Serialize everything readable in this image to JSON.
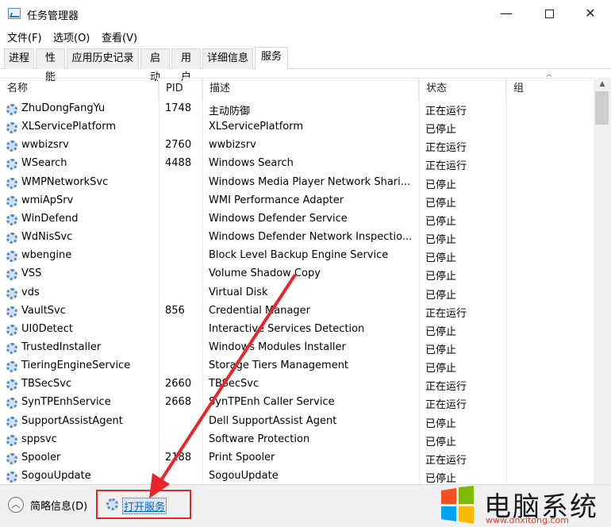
{
  "window": {
    "title": "任务管理器",
    "min_glyph": "—",
    "close_glyph": "✕"
  },
  "menu": [
    "文件(F)",
    "选项(O)",
    "查看(V)"
  ],
  "tabs": [
    {
      "label": "进程",
      "active": false
    },
    {
      "label": "性能",
      "active": false
    },
    {
      "label": "应用历史记录",
      "active": false
    },
    {
      "label": "启动",
      "active": false
    },
    {
      "label": "用户",
      "active": false
    },
    {
      "label": "详细信息",
      "active": false
    },
    {
      "label": "服务",
      "active": true
    }
  ],
  "columns": {
    "name": "名称",
    "pid": "PID",
    "desc": "描述",
    "status": "状态",
    "group": "组"
  },
  "services": [
    {
      "name": "ZhuDongFangYu",
      "pid": "1748",
      "desc": "主动防御",
      "status": "正在运行"
    },
    {
      "name": "XLServicePlatform",
      "pid": "",
      "desc": "XLServicePlatform",
      "status": "已停止"
    },
    {
      "name": "wwbizsrv",
      "pid": "2760",
      "desc": "wwbizsrv",
      "status": "正在运行"
    },
    {
      "name": "WSearch",
      "pid": "4488",
      "desc": "Windows Search",
      "status": "正在运行"
    },
    {
      "name": "WMPNetworkSvc",
      "pid": "",
      "desc": "Windows Media Player Network Shari...",
      "status": "已停止"
    },
    {
      "name": "wmiApSrv",
      "pid": "",
      "desc": "WMI Performance Adapter",
      "status": "已停止"
    },
    {
      "name": "WinDefend",
      "pid": "",
      "desc": "Windows Defender Service",
      "status": "已停止"
    },
    {
      "name": "WdNisSvc",
      "pid": "",
      "desc": "Windows Defender Network Inspectio...",
      "status": "已停止"
    },
    {
      "name": "wbengine",
      "pid": "",
      "desc": "Block Level Backup Engine Service",
      "status": "已停止"
    },
    {
      "name": "VSS",
      "pid": "",
      "desc": "Volume Shadow Copy",
      "status": "已停止"
    },
    {
      "name": "vds",
      "pid": "",
      "desc": "Virtual Disk",
      "status": "已停止"
    },
    {
      "name": "VaultSvc",
      "pid": "856",
      "desc": "Credential Manager",
      "status": "正在运行"
    },
    {
      "name": "UI0Detect",
      "pid": "",
      "desc": "Interactive Services Detection",
      "status": "已停止"
    },
    {
      "name": "TrustedInstaller",
      "pid": "",
      "desc": "Windows Modules Installer",
      "status": "已停止"
    },
    {
      "name": "TieringEngineService",
      "pid": "",
      "desc": "Storage Tiers Management",
      "status": "已停止"
    },
    {
      "name": "TBSecSvc",
      "pid": "2660",
      "desc": "TBSecSvc",
      "status": "正在运行"
    },
    {
      "name": "SynTPEnhService",
      "pid": "2668",
      "desc": "SynTPEnh Caller Service",
      "status": "正在运行"
    },
    {
      "name": "SupportAssistAgent",
      "pid": "",
      "desc": "Dell SupportAssist Agent",
      "status": "已停止"
    },
    {
      "name": "sppsvc",
      "pid": "",
      "desc": "Software Protection",
      "status": "已停止"
    },
    {
      "name": "Spooler",
      "pid": "2188",
      "desc": "Print Spooler",
      "status": "正在运行"
    },
    {
      "name": "SogouUpdate",
      "pid": "",
      "desc": "SogouUpdate",
      "status": "已停止"
    }
  ],
  "footer": {
    "fewer_details": "简略信息(D)",
    "open_services": "打开服务"
  },
  "annotation_color": "#e8252a",
  "watermark": {
    "text": "电脑系统",
    "url": "www.dnxitong.com"
  }
}
